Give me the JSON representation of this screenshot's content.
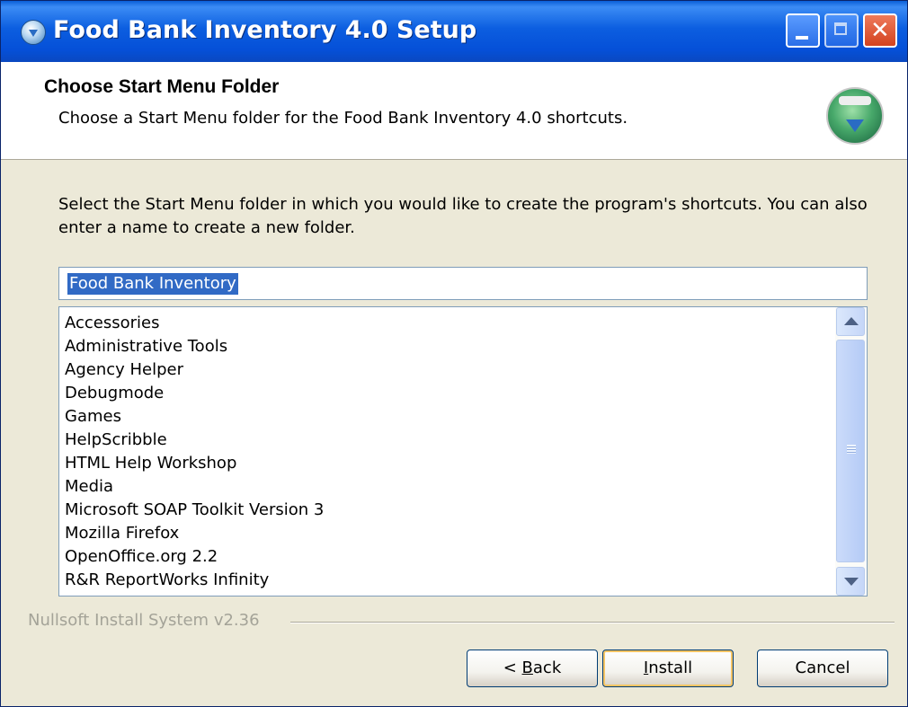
{
  "window": {
    "title": "Food Bank Inventory 4.0 Setup",
    "accent_color": "#0a5fd8",
    "icons": {
      "app": "installer-app-icon",
      "minimize": "minimize-icon",
      "maximize": "maximize-icon",
      "close": "close-icon"
    }
  },
  "header": {
    "title": "Choose Start Menu Folder",
    "subtitle": "Choose a Start Menu folder for the Food Bank Inventory 4.0 shortcuts.",
    "logo_icon": "installer-globe-icon"
  },
  "instructions": "Select the Start Menu folder in which you would like to create the program's shortcuts. You can also enter a name to create a new folder.",
  "folder_input": {
    "value": "Food Bank Inventory"
  },
  "folder_list": {
    "items": [
      "Accessories",
      "Administrative Tools",
      "Agency Helper",
      "Debugmode",
      "Games",
      "HelpScribble",
      "HTML Help Workshop",
      "Media",
      "Microsoft SOAP Toolkit Version 3",
      "Mozilla Firefox",
      "OpenOffice.org 2.2",
      "R&R ReportWorks Infinity"
    ]
  },
  "branding": "Nullsoft Install System v2.36",
  "buttons": {
    "back_prefix": "< ",
    "back_mnemonic": "B",
    "back_rest": "ack",
    "install_mnemonic": "I",
    "install_rest": "nstall",
    "cancel": "Cancel"
  }
}
